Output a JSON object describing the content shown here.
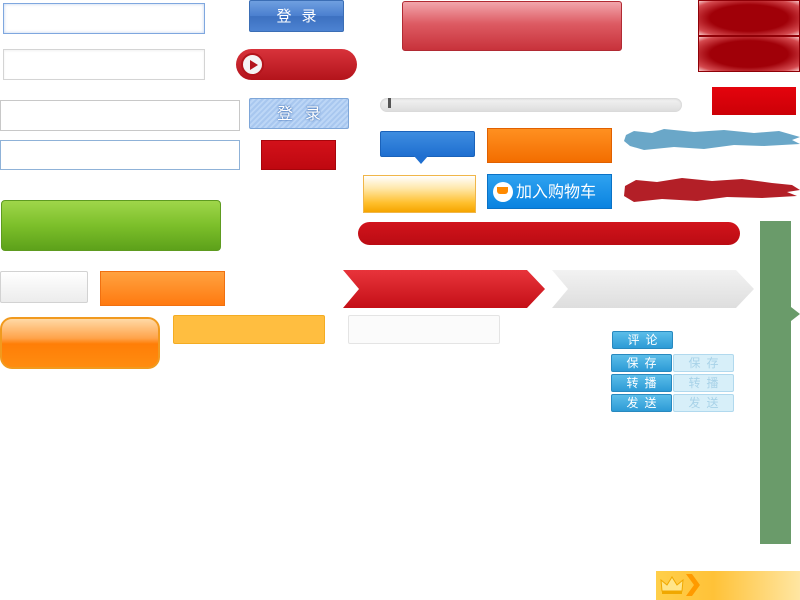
{
  "buttons": {
    "login_1": "登录",
    "login_2": "登录",
    "add_to_cart": "加入购物车",
    "comment": "评论",
    "save": "保存",
    "save_disabled": "保存",
    "forward": "转播",
    "forward_disabled": "转播",
    "send": "发送",
    "send_disabled": "发送"
  },
  "colors": {
    "accent_blue": "#1f6fd0",
    "accent_red": "#c8101a",
    "accent_orange": "#ff7e07",
    "accent_green": "#7cbf2a",
    "sidebar_green": "#6a9b6a"
  },
  "icons": {
    "play": "play-icon",
    "cart": "cart-icon",
    "crown": "crown-icon",
    "chevron": "chevron-right-icon"
  }
}
